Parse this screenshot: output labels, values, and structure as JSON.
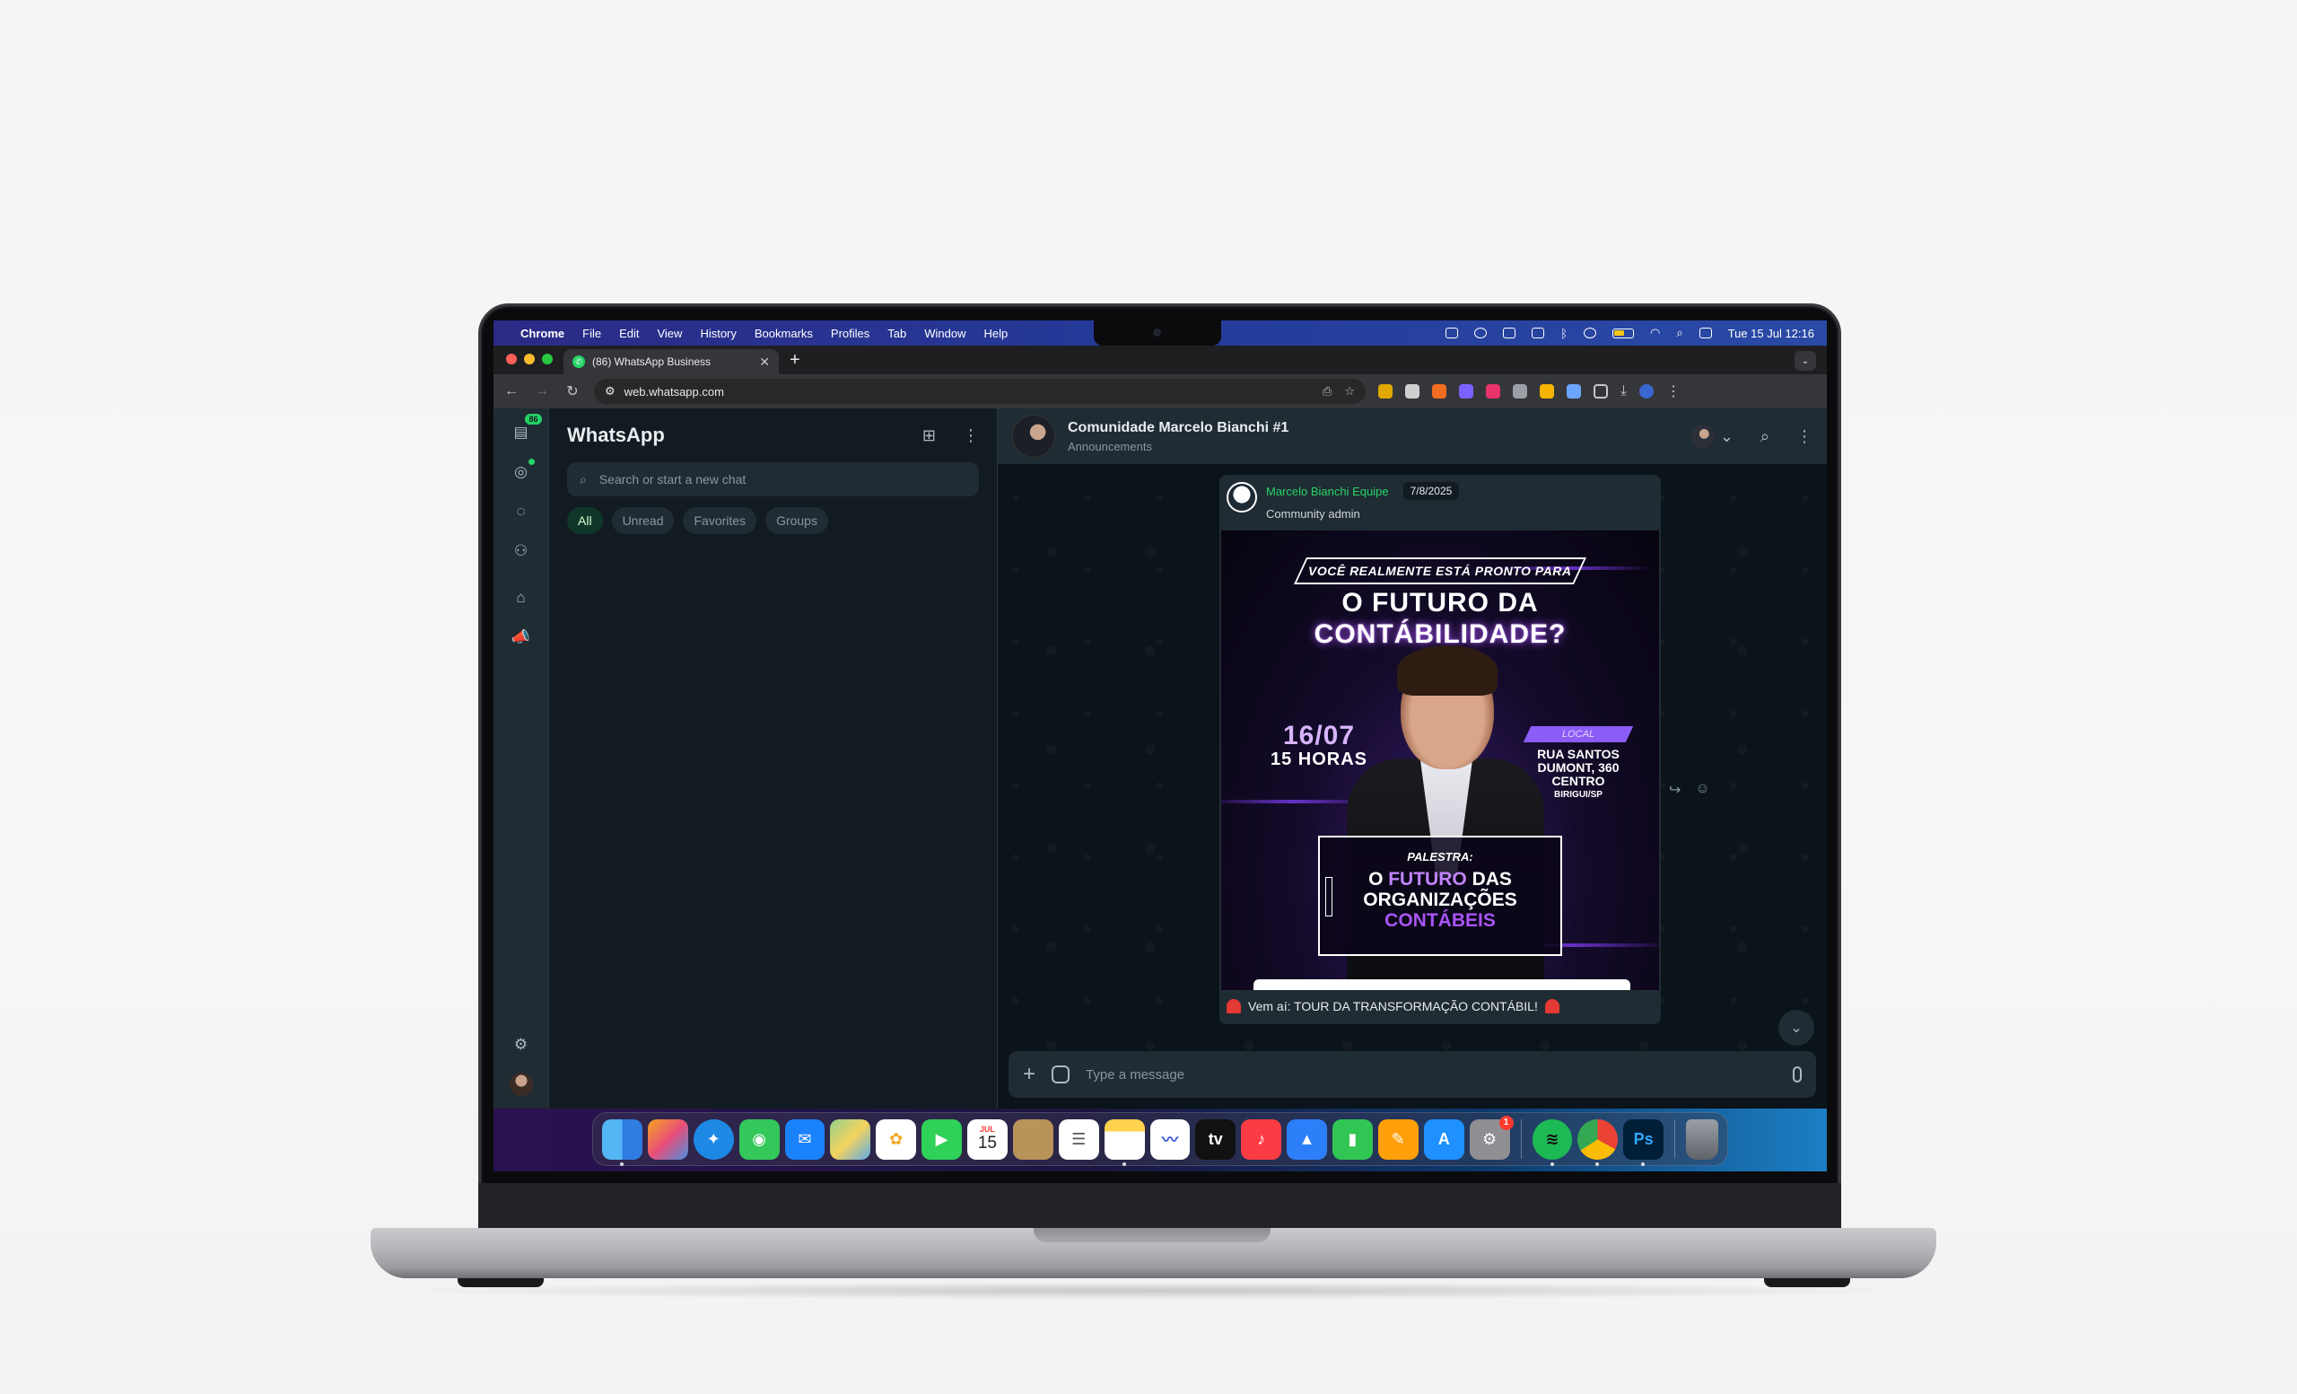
{
  "menubar": {
    "app": "Chrome",
    "items": [
      "File",
      "Edit",
      "View",
      "History",
      "Bookmarks",
      "Profiles",
      "Tab",
      "Window",
      "Help"
    ],
    "clock": "Tue 15 Jul  12:16"
  },
  "browser": {
    "tab_title": "(86) WhatsApp Business",
    "url": "web.whatsapp.com",
    "new_tab": "+",
    "tab_close": "✕"
  },
  "whatsapp": {
    "unread_badge": "86",
    "title": "WhatsApp",
    "search_placeholder": "Search or start a new chat",
    "filters": [
      "All",
      "Unread",
      "Favorites",
      "Groups"
    ],
    "active_filter": "All",
    "chat": {
      "title": "Comunidade Marcelo Bianchi  #1",
      "subtitle": "Announcements"
    },
    "message": {
      "sender": "Marcelo Bianchi Equipe",
      "date": "7/8/2025",
      "role": "Community admin",
      "caption": "Vem aí: TOUR DA TRANSFORMAÇÃO CONTÁBIL!"
    },
    "poster": {
      "banner_pre": "VOCÊ REALMENTE ",
      "banner_em": "ESTÁ PRONTO",
      "banner_post": " PARA",
      "headline_1": "O FUTURO DA",
      "headline_2": "CONTÁBILIDADE?",
      "date": "16/07",
      "time": "15 HORAS",
      "local_tag": "LOCAL",
      "address_1": "RUA SANTOS",
      "address_2": "DUMONT, 360",
      "address_3": "CENTRO",
      "city": "BIRIGUI/SP",
      "talk_label": "PALESTRA:",
      "talk_1a": "O ",
      "talk_1b": "FUTURO",
      "talk_1c": " DAS",
      "talk_2": "ORGANIZAÇÕES",
      "talk_3": "CONTÁBEIS"
    },
    "composer_placeholder": "Type a message"
  },
  "dock": {
    "calendar_month": "JUL",
    "calendar_day": "15",
    "settings_badge": "1",
    "ps_label": "Ps",
    "tv_label": "tv"
  },
  "colors": {
    "wa_green": "#25d366",
    "wa_panel": "#202c33",
    "wa_bg": "#111b21",
    "poster_purple": "#a855f7"
  }
}
